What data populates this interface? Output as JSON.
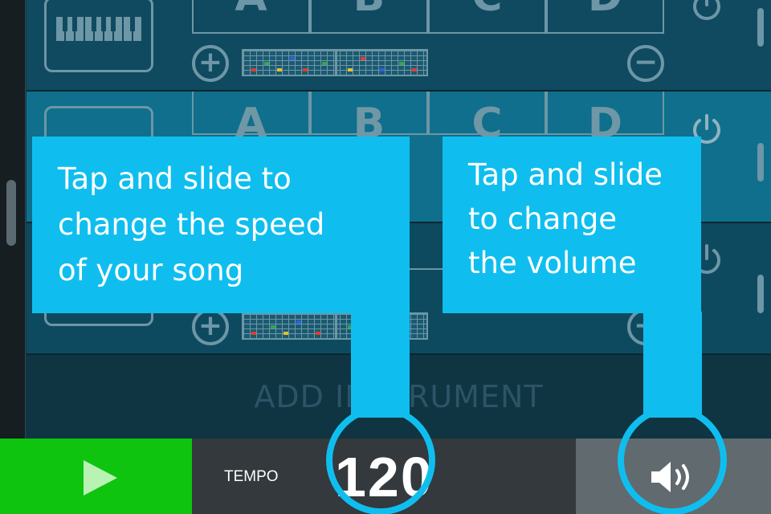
{
  "colors": {
    "tooltip": "#0fbeef",
    "play": "#0ec40f",
    "tempo_bar": "#33393c",
    "volume_bar": "#616a6e",
    "row_highlight": "#0f6f8c",
    "outline": "#6d96a6"
  },
  "rows": [
    {
      "patterns": [
        "A",
        "B",
        "C",
        "D"
      ],
      "icons": [
        "piano-icon",
        "plus-icon",
        "minus-icon",
        "power-icon"
      ]
    },
    {
      "patterns": [
        "A",
        "B",
        "C",
        "D"
      ],
      "icons": [
        "power-icon"
      ]
    },
    {
      "icons": [
        "plus-icon",
        "minus-icon",
        "power-icon"
      ]
    }
  ],
  "add_instrument": {
    "label": "ADD INSTRUMENT"
  },
  "toolbar": {
    "play_icon": "play-icon",
    "tempo_label": "TEMPO",
    "tempo_value": "120",
    "volume_icon": "speaker-icon"
  },
  "tooltips": {
    "tempo": {
      "lines": [
        "Tap and slide to",
        "change the speed",
        "of your song"
      ]
    },
    "volume": {
      "lines": [
        "Tap and slide",
        "to change",
        "the volume"
      ]
    }
  }
}
